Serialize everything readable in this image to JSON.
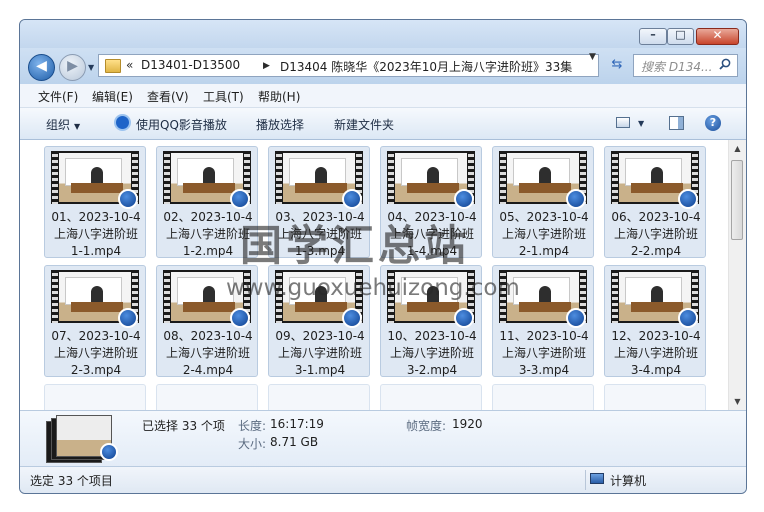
{
  "titlebar": {
    "minimize_glyph": "–",
    "maximize_glyph": "□",
    "close_glyph": "✕"
  },
  "nav": {
    "back_glyph": "◀",
    "forward_glyph": "▶",
    "recent_caret": "▼"
  },
  "address": {
    "overflow": "«",
    "separator": "▶",
    "crumbs": [
      "D13401-D13500",
      "D13404 陈晓华《2023年10月上海八字进阶班》33集"
    ],
    "dropdown_glyph": "▼",
    "refresh_glyph": "⇆"
  },
  "search": {
    "placeholder": "搜索 D134..."
  },
  "menu": {
    "items": [
      "文件(F)",
      "编辑(E)",
      "查看(V)",
      "工具(T)",
      "帮助(H)"
    ]
  },
  "toolbar": {
    "organize": "组织",
    "caret": "▼",
    "play_qq": "使用QQ影音播放",
    "play_select": "播放选择",
    "new_folder": "新建文件夹",
    "help_glyph": "?"
  },
  "files": [
    {
      "line1": "01、2023-10-4",
      "line2": "上海八字进阶班",
      "line3": "1-1.mp4"
    },
    {
      "line1": "02、2023-10-4",
      "line2": "上海八字进阶班",
      "line3": "1-2.mp4"
    },
    {
      "line1": "03、2023-10-4",
      "line2": "上海八字进阶班",
      "line3": "1-3.mp4"
    },
    {
      "line1": "04、2023-10-4",
      "line2": "上海八字进阶班",
      "line3": "1-4.mp4"
    },
    {
      "line1": "05、2023-10-4",
      "line2": "上海八字进阶班",
      "line3": "2-1.mp4"
    },
    {
      "line1": "06、2023-10-4",
      "line2": "上海八字进阶班",
      "line3": "2-2.mp4"
    },
    {
      "line1": "07、2023-10-4",
      "line2": "上海八字进阶班",
      "line3": "2-3.mp4"
    },
    {
      "line1": "08、2023-10-4",
      "line2": "上海八字进阶班",
      "line3": "2-4.mp4"
    },
    {
      "line1": "09、2023-10-4",
      "line2": "上海八字进阶班",
      "line3": "3-1.mp4"
    },
    {
      "line1": "10、2023-10-4",
      "line2": "上海八字进阶班",
      "line3": "3-2.mp4"
    },
    {
      "line1": "11、2023-10-4",
      "line2": "上海八字进阶班",
      "line3": "3-3.mp4"
    },
    {
      "line1": "12、2023-10-4",
      "line2": "上海八字进阶班",
      "line3": "3-4.mp4"
    }
  ],
  "details": {
    "selected": "已选择 33 个项",
    "length_label": "长度:",
    "length_value": "16:17:19",
    "size_label": "大小:",
    "size_value": "8.71 GB",
    "frame_width_label": "帧宽度:",
    "frame_width_value": "1920"
  },
  "status": {
    "text": "选定 33 个项目",
    "location": "计算机"
  },
  "watermark": {
    "cn": "国学汇总站",
    "url": "www.guoxuehuizong.com"
  },
  "scrollbar": {
    "up_glyph": "▲",
    "down_glyph": "▼"
  }
}
